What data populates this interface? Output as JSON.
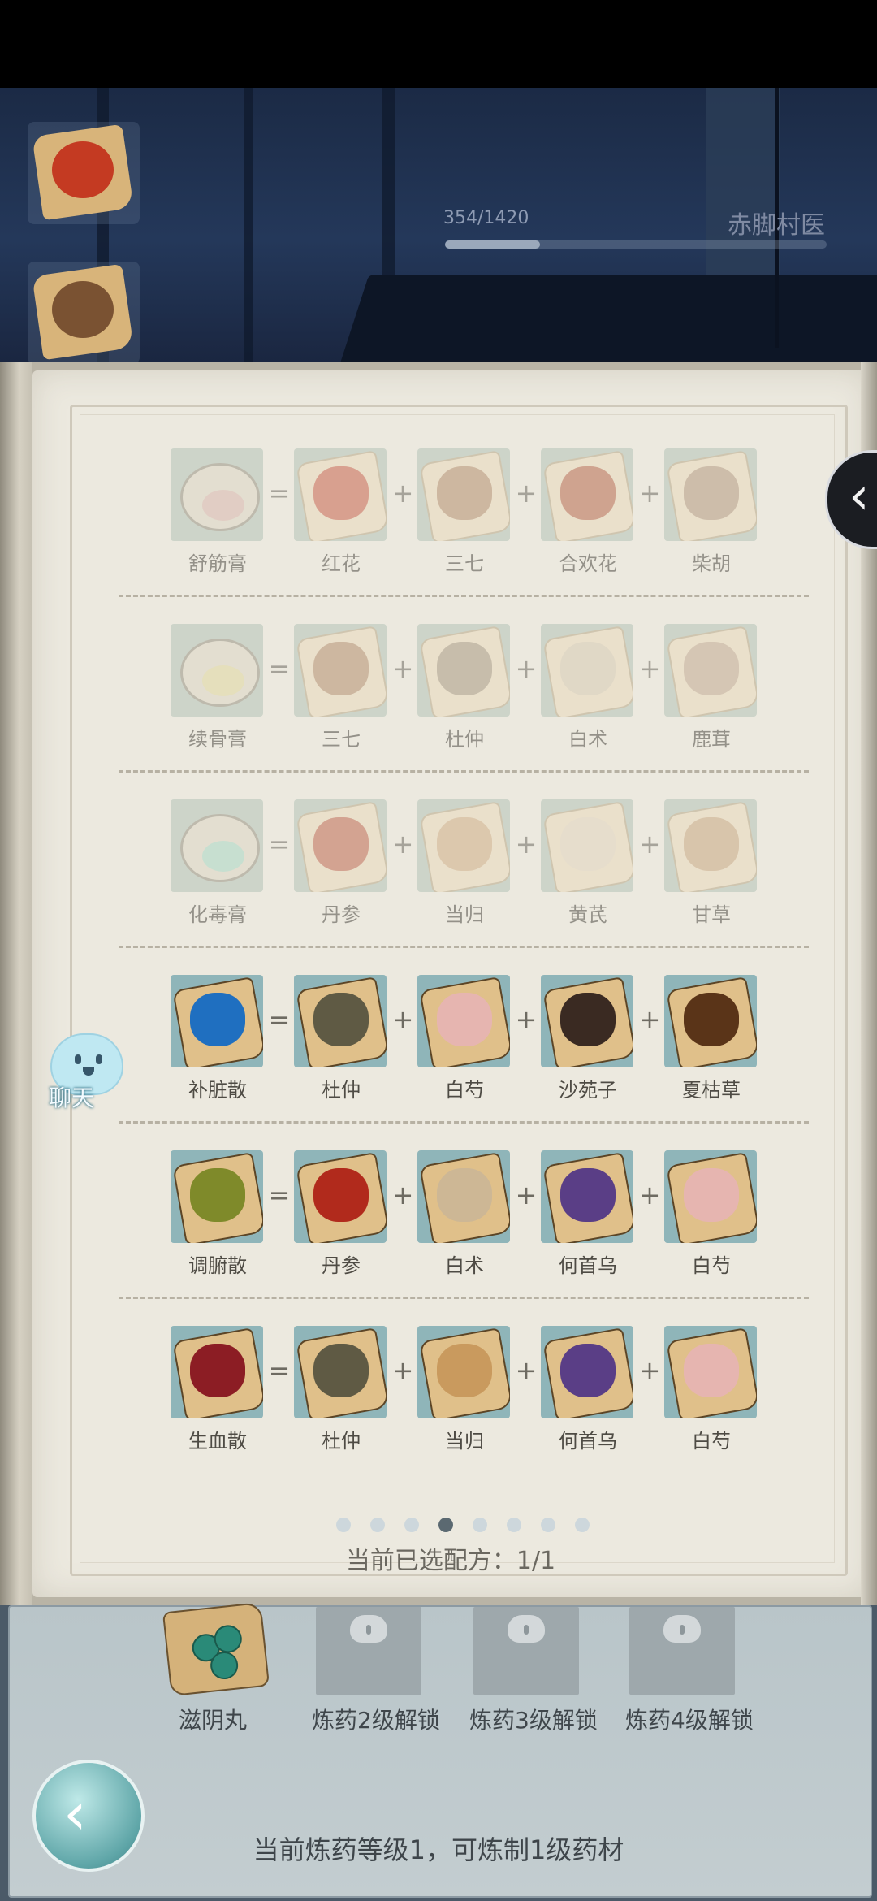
{
  "header": {
    "xp_text": "354/1420",
    "xp_progress": 0.249,
    "npc_title": "赤脚村医"
  },
  "top_herbs": [
    {
      "icon": "safflower-icon",
      "color": "#c43a22"
    },
    {
      "icon": "notoginseng-icon",
      "color": "#7a5232"
    }
  ],
  "recipes": [
    {
      "locked": true,
      "product": {
        "name": "舒筋膏",
        "icon": "ointment-jar-icon",
        "color": "#d9b7ae"
      },
      "equals": "=",
      "plus": "+",
      "ingredients": [
        {
          "name": "红花",
          "icon": "safflower-icon",
          "color": "#c9664e"
        },
        {
          "name": "三七",
          "icon": "notoginseng-icon",
          "color": "#b48f6e"
        },
        {
          "name": "合欢花",
          "icon": "albizia-flower-icon",
          "color": "#b86b4f"
        },
        {
          "name": "柴胡",
          "icon": "bupleurum-icon",
          "color": "#b59a7f"
        }
      ]
    },
    {
      "locked": true,
      "product": {
        "name": "续骨膏",
        "icon": "ointment-jar-icon",
        "color": "#e0d7a0"
      },
      "equals": "=",
      "plus": "+",
      "ingredients": [
        {
          "name": "三七",
          "icon": "notoginseng-icon",
          "color": "#b48f6e"
        },
        {
          "name": "杜仲",
          "icon": "eucommia-bark-icon",
          "color": "#a99a82"
        },
        {
          "name": "白术",
          "icon": "atractylodes-icon",
          "color": "#d8cbb3"
        },
        {
          "name": "鹿茸",
          "icon": "antler-icon",
          "color": "#c3ab91"
        }
      ]
    },
    {
      "locked": true,
      "product": {
        "name": "化毒膏",
        "icon": "ointment-jar-icon",
        "color": "#a9d8c4"
      },
      "equals": "=",
      "plus": "+",
      "ingredients": [
        {
          "name": "丹参",
          "icon": "salvia-root-icon",
          "color": "#c06a52"
        },
        {
          "name": "当归",
          "icon": "angelica-root-icon",
          "color": "#cfae86"
        },
        {
          "name": "黄芪",
          "icon": "astragalus-icon",
          "color": "#e2d4bd"
        },
        {
          "name": "甘草",
          "icon": "licorice-icon",
          "color": "#c9a881"
        }
      ]
    },
    {
      "locked": false,
      "product": {
        "name": "补脏散",
        "icon": "powder-icon",
        "color": "#1f6fc0"
      },
      "equals": "=",
      "plus": "+",
      "ingredients": [
        {
          "name": "杜仲",
          "icon": "eucommia-bark-icon",
          "color": "#5f5a44"
        },
        {
          "name": "白芍",
          "icon": "white-peony-icon",
          "color": "#e6b5b0"
        },
        {
          "name": "沙苑子",
          "icon": "seeds-icon",
          "color": "#3a2a22"
        },
        {
          "name": "夏枯草",
          "icon": "prunella-icon",
          "color": "#5a3418"
        }
      ]
    },
    {
      "locked": false,
      "product": {
        "name": "调腑散",
        "icon": "powder-icon",
        "color": "#7f8a2a"
      },
      "equals": "=",
      "plus": "+",
      "ingredients": [
        {
          "name": "丹参",
          "icon": "salvia-root-icon",
          "color": "#b12a1c"
        },
        {
          "name": "白术",
          "icon": "atractylodes-icon",
          "color": "#cdb795"
        },
        {
          "name": "何首乌",
          "icon": "fleeceflower-icon",
          "color": "#5a3e86"
        },
        {
          "name": "白芍",
          "icon": "white-peony-icon",
          "color": "#e6b5b0"
        }
      ]
    },
    {
      "locked": false,
      "product": {
        "name": "生血散",
        "icon": "powder-icon",
        "color": "#8c1d24"
      },
      "equals": "=",
      "plus": "+",
      "ingredients": [
        {
          "name": "杜仲",
          "icon": "eucommia-bark-icon",
          "color": "#5f5a44"
        },
        {
          "name": "当归",
          "icon": "angelica-root-icon",
          "color": "#c99a5e"
        },
        {
          "name": "何首乌",
          "icon": "fleeceflower-icon",
          "color": "#5a3e86"
        },
        {
          "name": "白芍",
          "icon": "white-peony-icon",
          "color": "#e6b5b0"
        }
      ]
    }
  ],
  "pagination": {
    "total": 8,
    "active": 3
  },
  "selected_text": "当前已选配方：1/1",
  "chat": {
    "label": "聊天"
  },
  "bottom": {
    "slots": [
      {
        "label": "滋阴丸",
        "locked": false,
        "icon": "pills-icon"
      },
      {
        "label": "炼药2级解锁",
        "locked": true,
        "icon": "lock-icon"
      },
      {
        "label": "炼药3级解锁",
        "locked": true,
        "icon": "lock-icon"
      },
      {
        "label": "炼药4级解锁",
        "locked": true,
        "icon": "lock-icon"
      }
    ],
    "status": "当前炼药等级1，可炼制1级药材"
  },
  "icons": {
    "nav": "chevron-left-icon",
    "back": "back-arrow-icon"
  },
  "colors": {
    "page": "#ece9df",
    "tile_active": "#8fb5b9",
    "dot_active": "#5b6971"
  }
}
